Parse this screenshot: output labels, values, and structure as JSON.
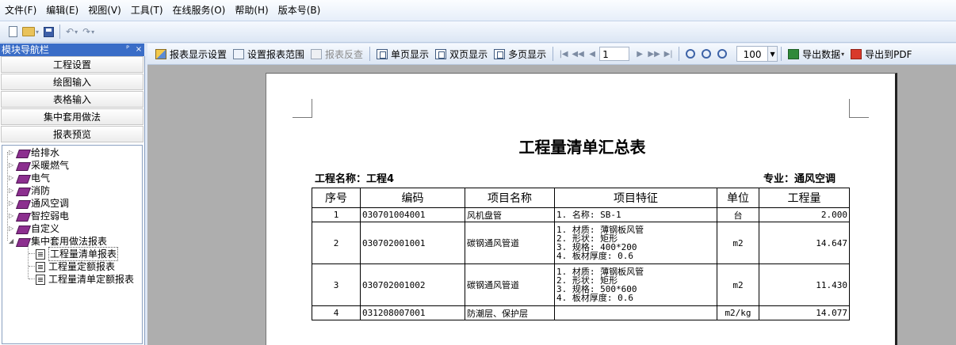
{
  "menubar": [
    "文件(F)",
    "编辑(E)",
    "视图(V)",
    "工具(T)",
    "在线服务(O)",
    "帮助(H)",
    "版本号(B)"
  ],
  "nav": {
    "title": "模块导航栏",
    "pin": "ᴾ",
    "close": "×",
    "buttons": [
      "工程设置",
      "绘图输入",
      "表格输入",
      "集中套用做法",
      "报表预览"
    ],
    "tree": [
      "给排水",
      "采暖燃气",
      "电气",
      "消防",
      "通风空调",
      "智控弱电",
      "自定义",
      "集中套用做法报表"
    ],
    "reports": [
      "工程量清单报表",
      "工程量定额报表",
      "工程量清单定额报表"
    ]
  },
  "report_toolbar": {
    "display_settings": "报表显示设置",
    "set_range": "设置报表范围",
    "reverse_lookup": "报表反查",
    "single_page": "单页显示",
    "double_page": "双页显示",
    "multi_page": "多页显示",
    "page_number": "1",
    "zoom": "100",
    "export_data": "导出数据",
    "export_pdf": "导出到PDF"
  },
  "report": {
    "title": "工程量清单汇总表",
    "project_label": "工程名称：工程4",
    "discipline_label": "专业：通风空调",
    "columns": [
      "序号",
      "编码",
      "项目名称",
      "项目特征",
      "单位",
      "工程量"
    ],
    "rows": [
      {
        "no": "1",
        "code": "030701004001",
        "name": "风机盘管",
        "feature": "1. 名称: SB-1",
        "unit": "台",
        "qty": "2.000"
      },
      {
        "no": "2",
        "code": "030702001001",
        "name": "碳钢通风管道",
        "feature": "1. 材质: 薄钢板风管\n2. 形状: 矩形\n3. 规格: 400*200\n4. 板材厚度: 0.6",
        "unit": "m2",
        "qty": "14.647"
      },
      {
        "no": "3",
        "code": "030702001002",
        "name": "碳钢通风管道",
        "feature": "1. 材质: 薄钢板风管\n2. 形状: 矩形\n3. 规格: 500*600\n4. 板材厚度: 0.6",
        "unit": "m2",
        "qty": "11.430"
      },
      {
        "no": "4",
        "code": "031208007001",
        "name": "防潮层、保护层",
        "feature": "",
        "unit": "m2/kg",
        "qty": "14.077"
      }
    ]
  }
}
